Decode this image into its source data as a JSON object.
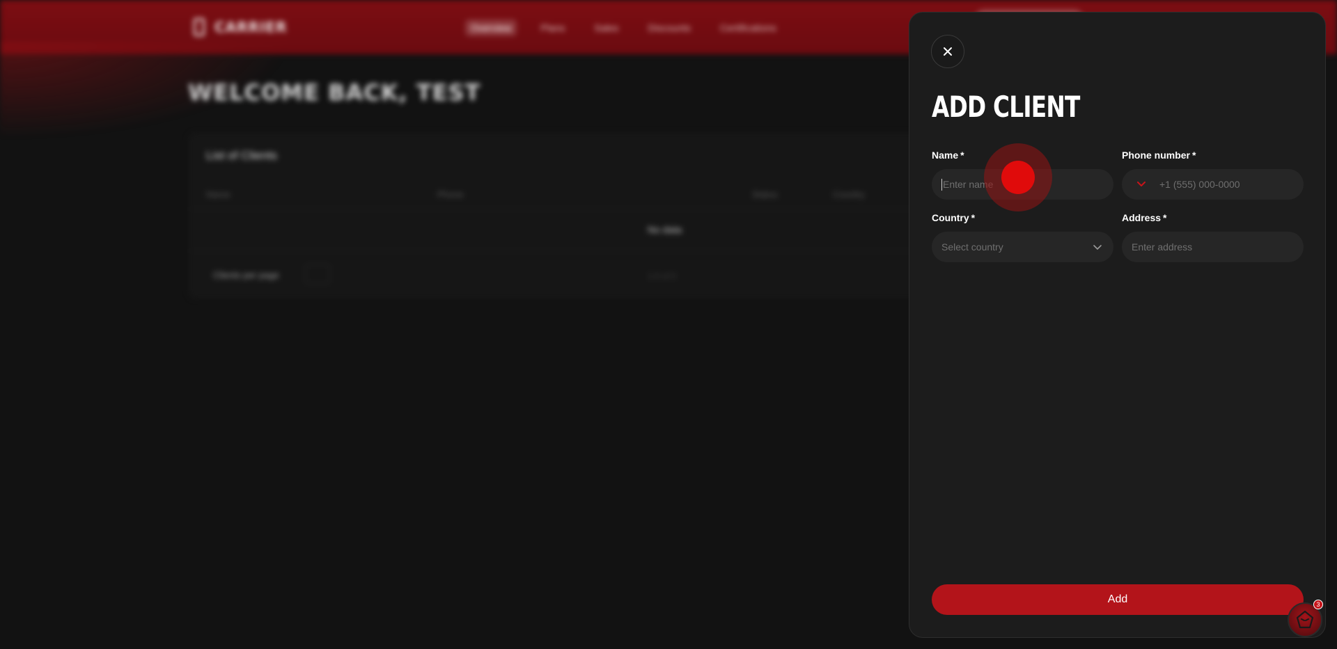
{
  "background": {
    "logo_text": "CARRIER",
    "nav": [
      "Overview",
      "Plans",
      "Sales",
      "Discounts",
      "Certifications"
    ],
    "welcome": "WELCOME BACK, TEST",
    "card_title": "List of Clients",
    "columns": [
      "Name",
      "Phone",
      "Status",
      "Country"
    ],
    "empty_text": "No data",
    "pager_text": "Clients per page",
    "pager_right": "1-0 of 0"
  },
  "drawer": {
    "title": "ADD CLIENT",
    "fields": {
      "name": {
        "label": "Name",
        "required": "*",
        "placeholder": "Enter name"
      },
      "phone": {
        "label": "Phone number",
        "required": "*",
        "placeholder": "+1 (555) 000-0000"
      },
      "country": {
        "label": "Country",
        "required": "*",
        "placeholder": "Select country"
      },
      "address": {
        "label": "Address",
        "required": "*",
        "placeholder": "Enter address"
      }
    },
    "submit_label": "Add"
  },
  "helper": {
    "badge_count": "3"
  },
  "colors": {
    "accent": "#b3141a",
    "header_bg": "#7c0d12",
    "drawer_bg": "#1c1c1c",
    "input_bg": "#262626"
  }
}
